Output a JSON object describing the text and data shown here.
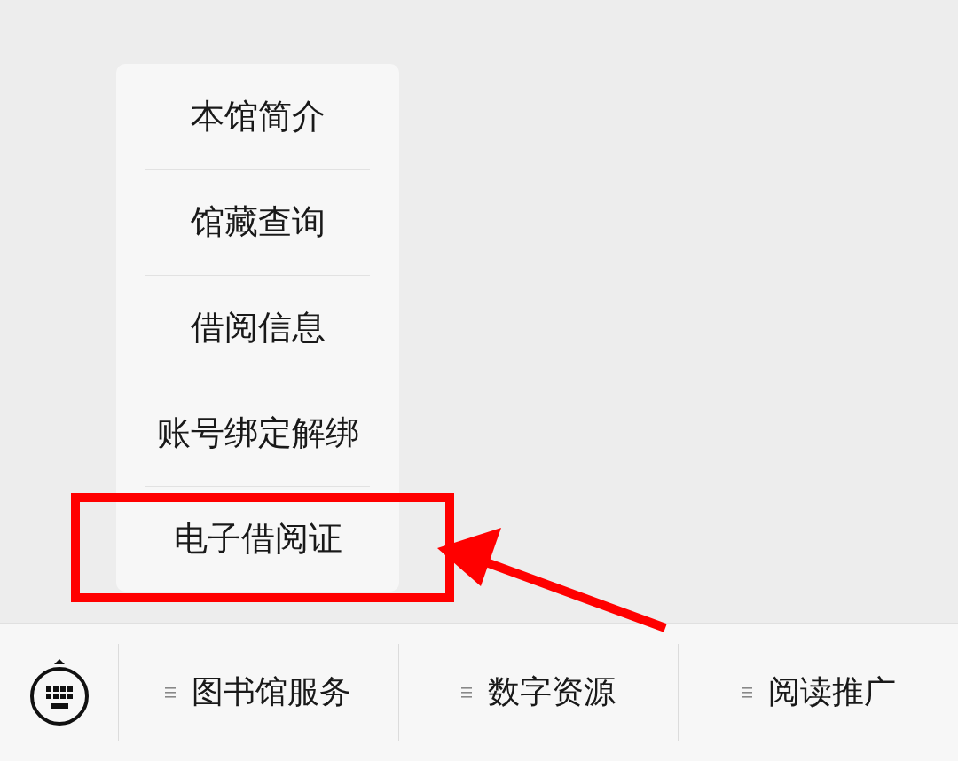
{
  "menu": {
    "items": [
      {
        "label": "本馆简介",
        "highlighted": false
      },
      {
        "label": "馆藏查询",
        "highlighted": false
      },
      {
        "label": "借阅信息",
        "highlighted": false
      },
      {
        "label": "账号绑定解绑",
        "highlighted": false
      },
      {
        "label": "电子借阅证",
        "highlighted": true
      }
    ]
  },
  "bottom_bar": {
    "tabs": [
      {
        "label": "图书馆服务"
      },
      {
        "label": "数字资源"
      },
      {
        "label": "阅读推广"
      }
    ]
  }
}
